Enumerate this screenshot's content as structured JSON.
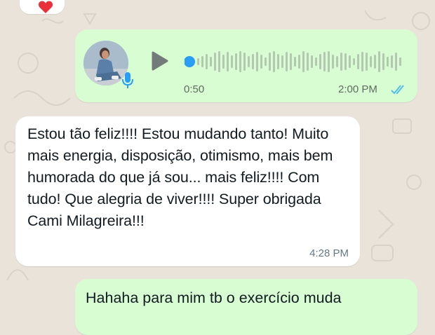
{
  "chat": {
    "voice_note": {
      "duration": "0:50",
      "time": "2:00 PM",
      "status": "read"
    },
    "incoming_message": {
      "text": "Estou tão feliz!!!! Estou mudando tanto! Muito mais energia, disposição, otimismo, mais bem humorada do que já sou... mais feliz!!!! Com tudo! Que alegria de viver!!!! Super obrigada Cami Milagreira!!!",
      "time": "4:28 PM"
    },
    "outgoing_partial": {
      "text": "Hahaha para mim tb o exercício muda"
    }
  },
  "colors": {
    "outgoing_bubble": "#d9fdd3",
    "incoming_bubble": "#ffffff",
    "read_ticks": "#53bdeb",
    "heart": "#e8313a",
    "progress_dot": "#2a9df4"
  },
  "icons": [
    "heart-icon",
    "mic-icon",
    "play-icon",
    "double-check-icon"
  ]
}
